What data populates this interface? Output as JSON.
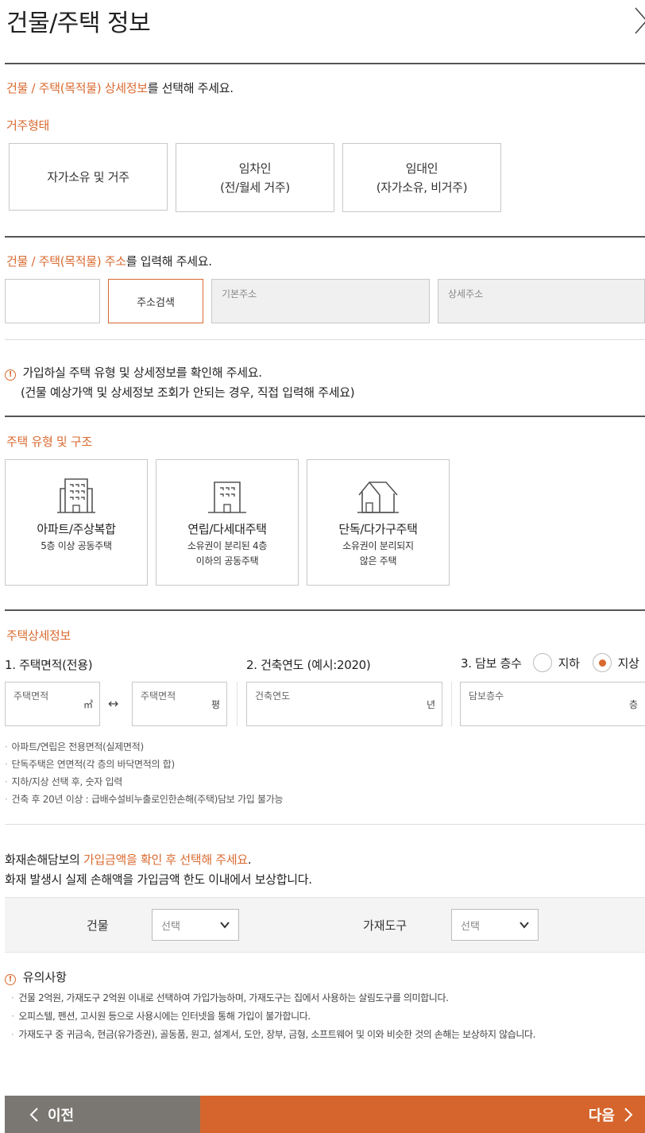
{
  "header": {
    "title": "건물/주택 정보"
  },
  "section1": {
    "lead_highlight": "건물 / 주택(목적물) 상세정보",
    "lead_rest": "를 선택해 주세요.",
    "subtitle": "거주형태",
    "options": [
      {
        "line1": "자가소유 및 거주",
        "line2": ""
      },
      {
        "line1": "임차인",
        "line2": "(전/월세 거주)"
      },
      {
        "line1": "임대인",
        "line2": "(자가소유, 비거주)"
      }
    ]
  },
  "section2": {
    "lead_highlight": "건물 / 주택(목적물) 주소",
    "lead_rest": "를 입력해 주세요.",
    "search_button": "주소검색",
    "basic_address_placeholder": "기본주소",
    "detail_address_placeholder": "상세주소"
  },
  "notice": {
    "icon": "!",
    "line1": "가입하실 주택 유형 및 상세정보를 확인해 주세요.",
    "line2": "(건물 예상가액 및 상세정보 조회가 안되는 경우, 직접 입력해 주세요)"
  },
  "section3": {
    "subtitle": "주택 유형 및 구조",
    "types": [
      {
        "icon": "apartment-icon",
        "title": "아파트/주상복합",
        "desc1": "5층 이상 공동주택",
        "desc2": ""
      },
      {
        "icon": "villa-icon",
        "title": "연립/다세대주택",
        "desc1": "소유권이 분리된 4층",
        "desc2": "이하의 공동주택"
      },
      {
        "icon": "house-icon",
        "title": "단독/다가구주택",
        "desc1": "소유권이 분리되지",
        "desc2": "않은 주택"
      }
    ]
  },
  "section4": {
    "subtitle": "주택상세정보",
    "area_label": "1. 주택면적(전용)",
    "year_label": "2. 건축연도 (예시:2020)",
    "floor_label": "3. 담보 층수",
    "radio_underground": "지하",
    "radio_ground": "지상",
    "radio_selected": "지상",
    "area_sqm_placeholder": "주택면적",
    "area_sqm_unit": "㎡",
    "convert_icon": "↔",
    "area_pyeong_placeholder": "주택면적",
    "area_pyeong_unit": "평",
    "year_placeholder": "건축연도",
    "year_unit": "년",
    "floor_placeholder": "담보층수",
    "floor_unit": "층",
    "bullets": [
      "아파트/연립은 전용면적(실제면적)",
      "단독주택은 연면적(각 층의 바닥면적의 합)",
      "지하/지상 선택 후, 숫자 입력",
      "건축 후 20년 이상 : 급배수설비누출로인한손해(주택)담보 가입 불가능"
    ]
  },
  "coverage": {
    "lead_prefix": "화재손해담보의 ",
    "lead_highlight": "가입금액을 확인 후 선택해 주세요",
    "lead_suffix": ".",
    "line2": "화재 발생시 실제 손해액을 가입금액 한도 이내에서 보상합니다.",
    "building_label": "건물",
    "building_select": "선택",
    "household_label": "가재도구",
    "household_select": "선택"
  },
  "caution": {
    "title": "유의사항",
    "items": [
      "건물 2억원, 가재도구 2억원 이내로 선택하여 가입가능하며, 가재도구는 집에서 사용하는 살림도구를 의미합니다.",
      "오피스텔, 펜션, 고시원 등으로 사용시에는 인터넷을 통해 가입이 불가합니다.",
      "가재도구 중 귀금속, 현금(유가증권), 골동품, 원고, 설계서, 도안, 장부, 금형, 소프트웨어 및 이와 비슷한 것의 손해는 보상하지 않습니다."
    ]
  },
  "footer": {
    "prev": "이전",
    "next": "다음"
  },
  "colors": {
    "accent": "#d9692f",
    "next_bg": "#d5652c",
    "prev_bg": "#7a7671"
  }
}
